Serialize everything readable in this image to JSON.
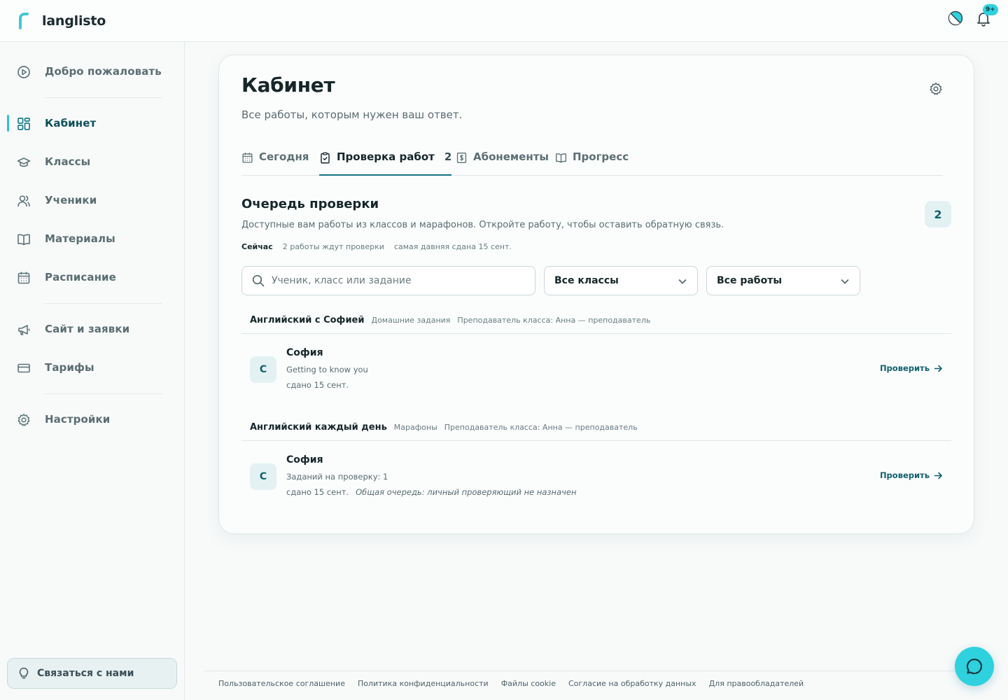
{
  "app": {
    "name": "langlisto",
    "notifications_badge": "9+",
    "accent_color": "#2fd1de",
    "primary_color": "#11606d"
  },
  "sidebar": {
    "items": [
      {
        "label": "Добро пожаловать",
        "icon": "play-circle-icon"
      },
      {
        "label": "Кабинет",
        "icon": "dashboard-grid-icon",
        "active": true
      },
      {
        "label": "Классы",
        "icon": "graduation-cap-icon"
      },
      {
        "label": "Ученики",
        "icon": "users-icon"
      },
      {
        "label": "Материалы",
        "icon": "book-open-icon"
      },
      {
        "label": "Расписание",
        "icon": "calendar-icon"
      },
      {
        "label": "Сайт и заявки",
        "icon": "megaphone-icon"
      },
      {
        "label": "Тарифы",
        "icon": "credit-card-icon"
      },
      {
        "label": "Настройки",
        "icon": "gear-icon"
      }
    ],
    "contact_label": "Связаться с нами"
  },
  "page": {
    "title": "Кабинет",
    "subtitle": "Все работы, которым нужен ваш ответ."
  },
  "tabs": [
    {
      "label": "Сегодня",
      "icon": "calendar-icon"
    },
    {
      "label": "Проверка работ",
      "icon": "clipboard-check-icon",
      "count": "2",
      "active": true
    },
    {
      "label": "Абонементы",
      "icon": "dollar-doc-icon"
    },
    {
      "label": "Прогресс",
      "icon": "book-open-icon"
    }
  ],
  "queue": {
    "title": "Очередь проверки",
    "description": "Доступные вам работы из классов и марафонов. Откройте работу, чтобы оставить обратную связь.",
    "count": "2",
    "stats_now": "Сейчас",
    "stats_waiting": "2 работы ждут проверки",
    "stats_oldest": "самая давняя сдана 15 сент."
  },
  "filters": {
    "search_placeholder": "Ученик, класс или задание",
    "classes_select": "Все классы",
    "works_select": "Все работы"
  },
  "groups": [
    {
      "name": "Английский с Софией",
      "type": "Домашние задания",
      "teacher": "Преподаватель класса: Анна — преподаватель",
      "rows": [
        {
          "initial": "С",
          "student": "София",
          "line2": "Getting to know you",
          "submitted": "сдано 15 сент.",
          "note": "",
          "action": "Проверить"
        }
      ]
    },
    {
      "name": "Английский каждый день",
      "type": "Марафоны",
      "teacher": "Преподаватель класса: Анна — преподаватель",
      "rows": [
        {
          "initial": "С",
          "student": "София",
          "line2": "Заданий на проверку: 1",
          "submitted": "сдано 15 сент.",
          "note": "Общая очередь: личный проверяющий не назначен",
          "action": "Проверить"
        }
      ]
    }
  ],
  "footer": {
    "links": [
      "Пользовательское соглашение",
      "Политика конфиденциальности",
      "Файлы cookie",
      "Согласие на обработку данных",
      "Для правообладателей"
    ]
  }
}
